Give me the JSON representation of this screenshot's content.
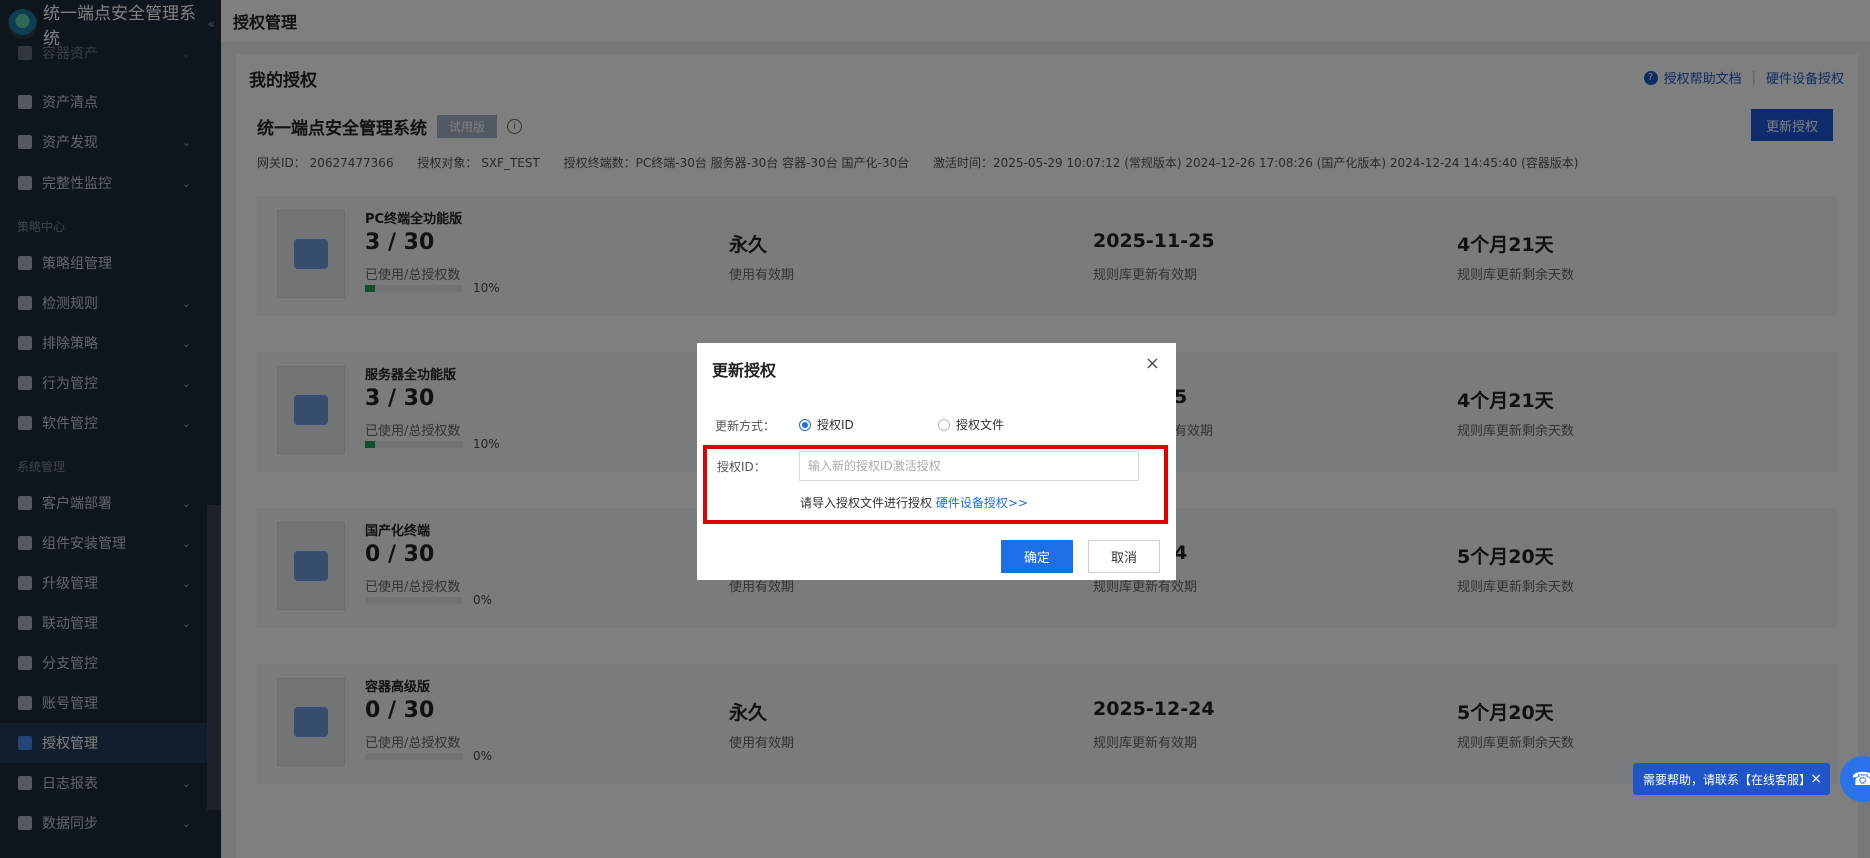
{
  "sidebar": {
    "app_title": "统一端点安全管理系统",
    "collapse_icon": "«",
    "items": [
      {
        "label": "容器资产",
        "icon": "container-icon",
        "has_children": true
      },
      {
        "label": "资产清点",
        "icon": "inventory-icon",
        "has_children": false
      },
      {
        "label": "资产发现",
        "icon": "search-icon",
        "has_children": true
      },
      {
        "label": "完整性监控",
        "icon": "pie-icon",
        "has_children": true
      },
      {
        "label": "策略组管理",
        "icon": "policy-group-icon",
        "has_children": false
      },
      {
        "label": "检测规则",
        "icon": "rule-icon",
        "has_children": true
      },
      {
        "label": "排除策略",
        "icon": "exclude-icon",
        "has_children": true
      },
      {
        "label": "行为管控",
        "icon": "behavior-icon",
        "has_children": true
      },
      {
        "label": "软件管控",
        "icon": "software-icon",
        "has_children": true
      },
      {
        "label": "客户端部署",
        "icon": "deploy-icon",
        "has_children": true
      },
      {
        "label": "组件安装管理",
        "icon": "component-icon",
        "has_children": true
      },
      {
        "label": "升级管理",
        "icon": "upgrade-icon",
        "has_children": true
      },
      {
        "label": "联动管理",
        "icon": "link-icon",
        "has_children": true
      },
      {
        "label": "分支管控",
        "icon": "branch-icon",
        "has_children": false
      },
      {
        "label": "账号管理",
        "icon": "account-icon",
        "has_children": false
      },
      {
        "label": "授权管理",
        "icon": "lock-icon",
        "has_children": false,
        "active": true
      },
      {
        "label": "日志报表",
        "icon": "log-icon",
        "has_children": true
      },
      {
        "label": "数据同步",
        "icon": "sync-icon",
        "has_children": true
      }
    ],
    "sections": {
      "strategy": "策略中心",
      "system": "系统管理"
    }
  },
  "header": {
    "title": "授权管理"
  },
  "main": {
    "title": "我的授权",
    "help_doc": "授权帮助文档",
    "hw_auth": "硬件设备授权",
    "product_name": "统一端点安全管理系统",
    "badge": "试用版",
    "update_button": "更新授权",
    "meta": {
      "gateway": "网关ID： 20627477366",
      "target": "授权对象： SXF_TEST",
      "terminals": "授权终端数：PC终端-30台   服务器-30台   容器-30台   国产化-30台",
      "activation": "激活时间：2025-05-29 10:07:12 (常规版本)   2024-12-26 17:08:26 (国产化版本)   2024-12-24 14:45:40 (容器版本)"
    },
    "cards": [
      {
        "name": "PC终端全功能版",
        "count": "3 / 30",
        "count_label": "已使用/总授权数",
        "progress": 0.1,
        "pct": "10%",
        "validity": "永久",
        "validity_label": "使用有效期",
        "rule_date": "2025-11-25",
        "rule_date_label": "规则库更新有效期",
        "remain": "4个月21天",
        "remain_label": "规则库更新剩余天数"
      },
      {
        "name": "服务器全功能版",
        "count": "3 / 30",
        "count_label": "已使用/总授权数",
        "progress": 0.1,
        "pct": "10%",
        "validity": "",
        "validity_label": "",
        "rule_date": "5",
        "rule_date_label": "有效期",
        "remain": "4个月21天",
        "remain_label": "规则库更新剩余天数"
      },
      {
        "name": "国产化终端",
        "count": "0 / 30",
        "count_label": "已使用/总授权数",
        "progress": 0.0,
        "pct": "0%",
        "validity": "",
        "validity_label": "使用有效期",
        "rule_date": "4",
        "rule_date_label": "规则库更新有效期",
        "remain": "5个月20天",
        "remain_label": "规则库更新剩余天数"
      },
      {
        "name": "容器高级版",
        "count": "0 / 30",
        "count_label": "已使用/总授权数",
        "progress": 0.0,
        "pct": "0%",
        "validity": "永久",
        "validity_label": "使用有效期",
        "rule_date": "2025-12-24",
        "rule_date_label": "规则库更新有效期",
        "remain": "5个月20天",
        "remain_label": "规则库更新剩余天数"
      }
    ]
  },
  "modal": {
    "title": "更新授权",
    "close": "×",
    "method_label": "更新方式：",
    "option_id": "授权ID",
    "option_file": "授权文件",
    "selected": "授权ID",
    "id_label": "授权ID：",
    "id_placeholder": "输入新的授权ID激活授权",
    "id_value": "",
    "hint_text": "请导入授权文件进行授权",
    "hint_link": "硬件设备授权>>",
    "ok": "确定",
    "cancel": "取消"
  },
  "help_float": {
    "text": "需要帮助，请联系【在线客服】",
    "close": "×"
  },
  "colors": {
    "accent": "#1d6fe8",
    "sidebar_bg": "#1e2a3b",
    "highlight": "#e00000",
    "progress": "#1e9e5e"
  }
}
